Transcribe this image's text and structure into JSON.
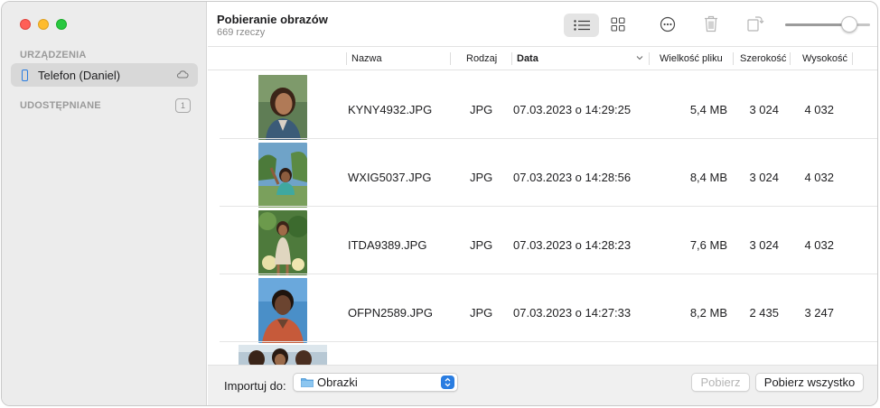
{
  "sidebar": {
    "devices_heading": "URZĄDZENIA",
    "device_label": "Telefon (Daniel)",
    "shared_heading": "UDOSTĘPNIANE",
    "shared_count": "1"
  },
  "toolbar": {
    "title": "Pobieranie obrazów",
    "subtitle": "669 rzeczy",
    "view_list_icon": "list-view-icon",
    "view_grid_icon": "grid-view-icon",
    "more_icon": "ellipsis-circle-icon",
    "delete_icon": "trash-icon",
    "rotate_icon": "rotate-icon",
    "thumbnail_size": 0.75
  },
  "columns": {
    "name": "Nazwa",
    "kind": "Rodzaj",
    "date": "Data",
    "size": "Wielkość pliku",
    "width": "Szerokość",
    "height": "Wysokość"
  },
  "rows": [
    {
      "name": "KYNY4932.JPG",
      "kind": "JPG",
      "date": "07.03.2023 o 14:29:25",
      "size": "5,4 MB",
      "width": "3 024",
      "height": "4 032"
    },
    {
      "name": "WXIG5037.JPG",
      "kind": "JPG",
      "date": "07.03.2023 o 14:28:56",
      "size": "8,4 MB",
      "width": "3 024",
      "height": "4 032"
    },
    {
      "name": "ITDA9389.JPG",
      "kind": "JPG",
      "date": "07.03.2023 o 14:28:23",
      "size": "7,6 MB",
      "width": "3 024",
      "height": "4 032"
    },
    {
      "name": "OFPN2589.JPG",
      "kind": "JPG",
      "date": "07.03.2023 o 14:27:33",
      "size": "8,2 MB",
      "width": "2 435",
      "height": "3 247"
    }
  ],
  "footer": {
    "import_to_label": "Importuj do:",
    "destination": "Obrazki",
    "import_button": "Pobierz",
    "import_all_button": "Pobierz wszystko"
  },
  "colors": {
    "accent": "#2a7de1",
    "sidebar_bg": "#ececec",
    "selected_item_bg": "#d8d8d8"
  }
}
